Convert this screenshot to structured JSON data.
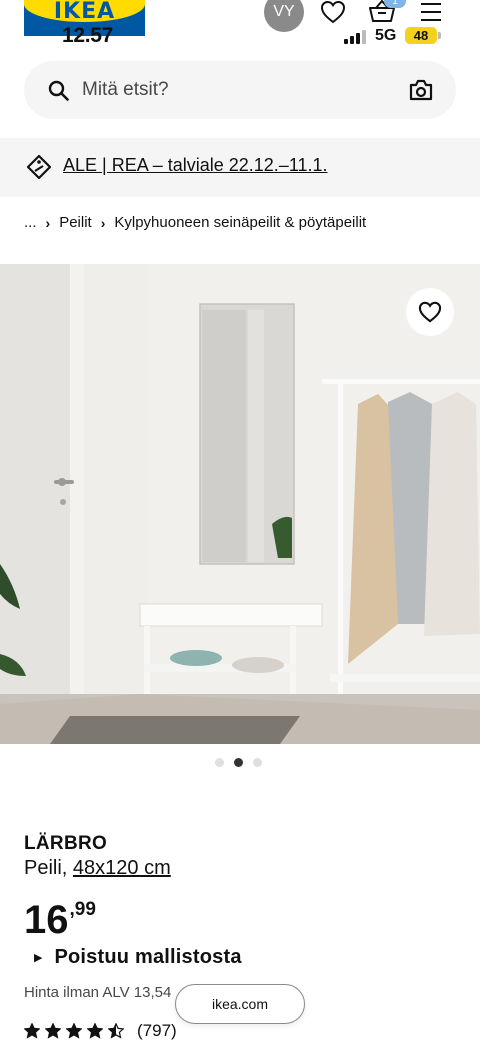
{
  "header": {
    "logo_text": "IKEA",
    "clock": "12.57",
    "avatar_initials": "VY",
    "network": "5G",
    "battery": "48",
    "cart_count": "1"
  },
  "search": {
    "placeholder": "Mitä etsit?"
  },
  "promo": {
    "text": "ALE | REA – talviale 22.12.–11.1."
  },
  "breadcrumb": {
    "ellipsis": "...",
    "items": [
      "Peilit",
      "Kylpyhuoneen seinäpeilit & pöytäpeilit"
    ]
  },
  "gallery": {
    "image_count": 3,
    "active_index": 1
  },
  "product": {
    "name": "LÄRBRO",
    "type": "Peili,",
    "size": "48x120 cm",
    "price_integer": "16",
    "price_decimal": ",99",
    "status": "Poistuu mallistosta",
    "vat_text": "Hinta ilman ALV 13,54",
    "rating_value": 4.5,
    "review_count": "(797)"
  },
  "browser": {
    "url": "ikea.com"
  },
  "colors": {
    "ikea_blue": "#0058a3",
    "ikea_yellow": "#ffdb00",
    "badge_blue": "#7fb6e8",
    "battery_yellow": "#f2d21a"
  }
}
